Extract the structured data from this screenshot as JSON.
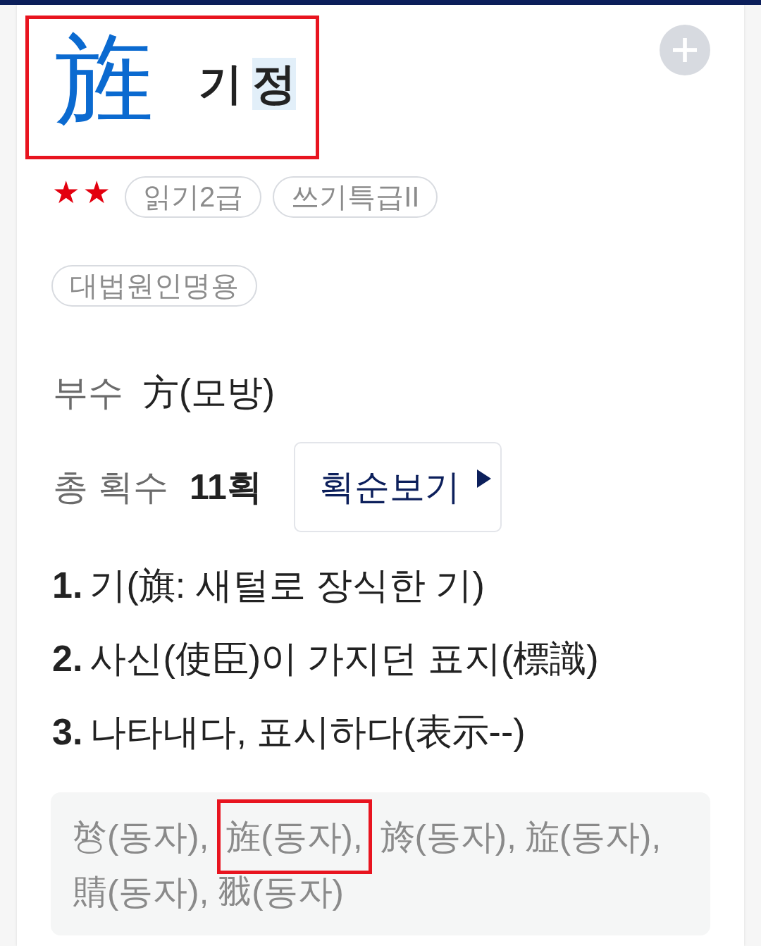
{
  "header": {
    "hanja": "旌",
    "highlighted": true,
    "readings": [
      {
        "text": "기",
        "selected": false
      },
      {
        "text": "정",
        "selected": true
      }
    ]
  },
  "level": {
    "mark": "★★",
    "tags": [
      "읽기2급",
      "쓰기특급II"
    ]
  },
  "name_tags": [
    "대법원인명용"
  ],
  "radical": {
    "label": "부수",
    "value": "方(모방)"
  },
  "strokes": {
    "label": "총 획수",
    "value": "11획",
    "button": "획순보기"
  },
  "meanings": [
    {
      "number": "1.",
      "text": "기(旗: 새털로 장식한 기)"
    },
    {
      "number": "2.",
      "text": "사신(使臣)이 가지던 표지(標識)"
    },
    {
      "number": "3.",
      "text": "나타내다, 표시하다(表示--)"
    }
  ],
  "variants": [
    {
      "text": "㫈(동자),",
      "highlighted": false
    },
    {
      "text": "旌(동자),",
      "highlighted": true
    },
    {
      "text": "旍(동자),",
      "highlighted": false
    },
    {
      "text": "㫌(동자),",
      "highlighted": false
    },
    {
      "text": "䝼(동자),",
      "highlighted": false
    },
    {
      "text": "𦐂(동자)",
      "highlighted": false
    }
  ]
}
